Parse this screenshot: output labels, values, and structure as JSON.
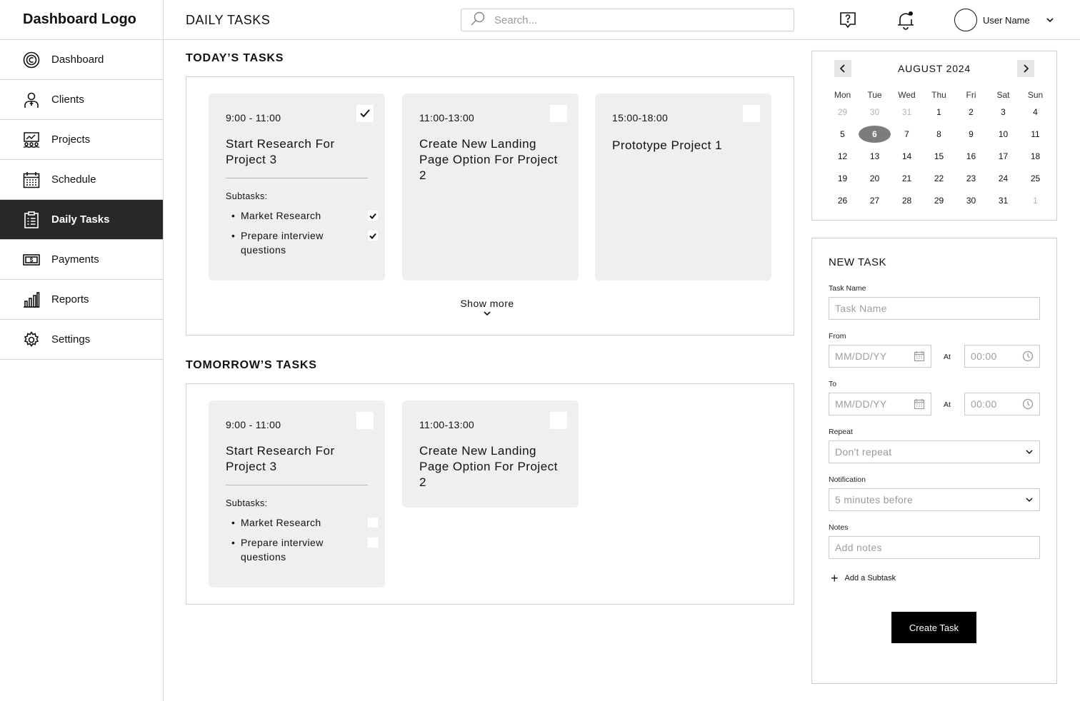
{
  "sidebar": {
    "logo": "Dashboard Logo",
    "items": [
      {
        "label": "Dashboard",
        "icon": "dashboard-icon"
      },
      {
        "label": "Clients",
        "icon": "client-icon"
      },
      {
        "label": "Projects",
        "icon": "projects-icon"
      },
      {
        "label": "Schedule",
        "icon": "calendar-icon"
      },
      {
        "label": "Daily Tasks",
        "icon": "clipboard-icon",
        "active": true
      },
      {
        "label": "Payments",
        "icon": "money-icon"
      },
      {
        "label": "Reports",
        "icon": "bar-chart-icon"
      },
      {
        "label": "Settings",
        "icon": "gear-icon"
      }
    ]
  },
  "header": {
    "title": "DAILY TASKS",
    "search_placeholder": "Search...",
    "user_name": "User Name"
  },
  "today": {
    "title": "TODAY’S TASKS",
    "show_more": "Show more",
    "cards": [
      {
        "time": "9:00 - 11:00",
        "title": "Start Research For Project 3",
        "done": true,
        "subtasks_label": "Subtasks:",
        "subtasks": [
          {
            "label": "Market Research",
            "done": true
          },
          {
            "label": "Prepare interview questions",
            "done": true
          }
        ]
      },
      {
        "time": "11:00-13:00",
        "title": "Create New Landing Page Option For Project 2",
        "done": false
      },
      {
        "time": "15:00-18:00",
        "title": "Prototype Project 1",
        "done": false
      }
    ]
  },
  "tomorrow": {
    "title": "TOMORROW’S TASKS",
    "cards": [
      {
        "time": "9:00 - 11:00",
        "title": "Start Research For Project 3",
        "done": false,
        "subtasks_label": "Subtasks:",
        "subtasks": [
          {
            "label": "Market Research",
            "done": false
          },
          {
            "label": "Prepare interview questions",
            "done": false
          }
        ]
      },
      {
        "time": "11:00-13:00",
        "title": "Create New Landing Page Option For Project 2",
        "done": false
      }
    ]
  },
  "calendar": {
    "month_label": "AUGUST 2024",
    "weekdays": [
      "Mon",
      "Tue",
      "Wed",
      "Thu",
      "Fri",
      "Sat",
      "Sun"
    ],
    "selected_day": "6",
    "weeks": [
      [
        "29",
        "30",
        "31",
        "1",
        "2",
        "3",
        "4"
      ],
      [
        "5",
        "6",
        "7",
        "8",
        "9",
        "10",
        "11"
      ],
      [
        "12",
        "13",
        "14",
        "15",
        "16",
        "17",
        "18"
      ],
      [
        "19",
        "20",
        "21",
        "22",
        "23",
        "24",
        "25"
      ],
      [
        "26",
        "27",
        "28",
        "29",
        "30",
        "31",
        "1"
      ]
    ]
  },
  "new_task": {
    "title": "NEW TASK",
    "task_name_label": "Task Name",
    "task_name_placeholder": "Task Name",
    "from_label": "From",
    "to_label": "To",
    "date_placeholder": "MM/DD/YY",
    "at_label": "At",
    "time_placeholder": "00:00",
    "repeat_label": "Repeat",
    "repeat_value": "Don't repeat",
    "notification_label": "Notification",
    "notification_value": "5 minutes before",
    "notes_label": "Notes",
    "notes_placeholder": "Add notes",
    "add_subtask": "Add a Subtask",
    "create_button": "Create Task"
  }
}
